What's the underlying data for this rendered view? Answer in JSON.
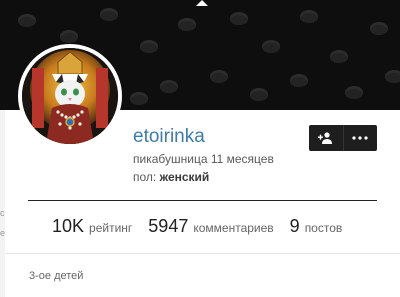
{
  "profile": {
    "username": "etoirinka",
    "subtitle": "пикабушница 11 месяцев",
    "gender_label": "пол:",
    "gender_value": "женский",
    "about": "3-ое детей"
  },
  "actions": {
    "subscribe_icon": "add-user-icon",
    "more_icon": "more-dots-icon"
  },
  "stats": [
    {
      "value": "10K",
      "label": "рейтинг"
    },
    {
      "value": "5947",
      "label": "комментариев"
    },
    {
      "value": "9",
      "label": "постов"
    }
  ],
  "colors": {
    "username": "#3d7ca8",
    "banner": "#0e0e0e",
    "button": "#1e1e1e"
  }
}
